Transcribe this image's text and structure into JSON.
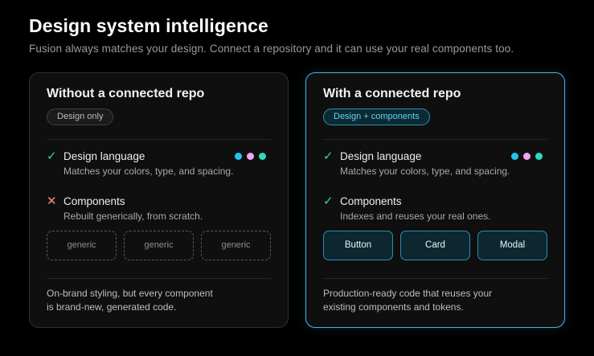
{
  "header": {
    "title": "Design system intelligence",
    "subtitle": "Fusion always matches your design. Connect a repository and it can use your real components too."
  },
  "left_card": {
    "title": "Without a connected repo",
    "badge": "Design only",
    "features": [
      {
        "status": "check",
        "title": "Design language",
        "description": "Matches your colors, type, and spacing."
      },
      {
        "status": "cross",
        "title": "Components",
        "description": "Rebuilt generically, from scratch."
      }
    ],
    "chips": [
      "generic",
      "generic",
      "generic"
    ],
    "footer_line1": "On-brand styling, but every component",
    "footer_line2": "is brand-new, generated code."
  },
  "right_card": {
    "title": "With a connected repo",
    "badge": "Design + components",
    "features": [
      {
        "status": "check",
        "title": "Design language",
        "description": "Matches your colors, type, and spacing."
      },
      {
        "status": "check",
        "title": "Components",
        "description": "Indexes and reuses your real ones."
      }
    ],
    "chips": [
      "Button",
      "Card",
      "Modal"
    ],
    "footer_line1": "Production-ready code that reuses your",
    "footer_line2": "existing components and tokens."
  },
  "swatch_colors": [
    "#22c4ee",
    "#f3a4f0",
    "#2bdcbb"
  ],
  "accent_color": "#3fb6d8",
  "check_color": "#34d5a2",
  "cross_color": "#ff8f7d",
  "icons": {
    "check": "check-icon",
    "cross": "cross-icon"
  }
}
